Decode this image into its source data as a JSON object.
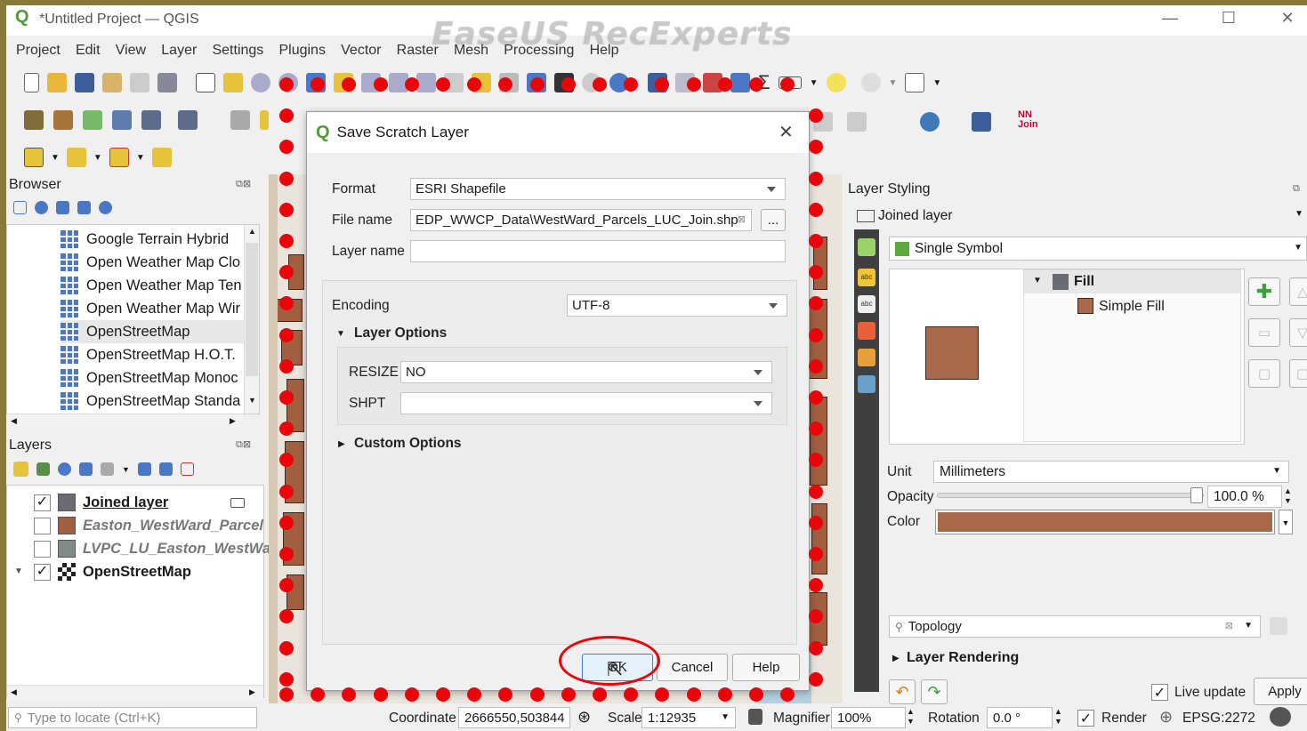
{
  "window": {
    "title": "*Untitled Project — QGIS",
    "watermark": "EaseUS RecExperts"
  },
  "menu": [
    "Project",
    "Edit",
    "View",
    "Layer",
    "Settings",
    "Plugins",
    "Vector",
    "Raster",
    "Mesh",
    "Processing",
    "Help"
  ],
  "browser": {
    "title": "Browser",
    "items": [
      "Google Terrain Hybrid",
      "Open Weather Map Clo",
      "Open Weather Map Ten",
      "Open Weather Map Wir",
      "OpenStreetMap",
      "OpenStreetMap H.O.T.",
      "OpenStreetMap Monoc",
      "OpenStreetMap Standa"
    ]
  },
  "layers": {
    "title": "Layers",
    "items": [
      {
        "name": "Joined layer",
        "checked": "✓",
        "color": "#6b6b74"
      },
      {
        "name": "Easton_WestWard_Parcel",
        "checked": "",
        "color": "#a15f40"
      },
      {
        "name": "LVPC_LU_Easton_WestWa",
        "checked": "",
        "color": "#7f8c8a"
      },
      {
        "name": "OpenStreetMap",
        "checked": "✓",
        "color": ""
      }
    ]
  },
  "dialog": {
    "title": "Save Scratch Layer",
    "format_label": "Format",
    "format_value": "ESRI Shapefile",
    "filename_label": "File name",
    "filename_value": "EDP_WWCP_Data\\WestWard_Parcels_LUC_Join.shp",
    "browse_label": "...",
    "layername_label": "Layer name",
    "layername_value": "",
    "encoding_label": "Encoding",
    "encoding_value": "UTF-8",
    "layer_options_label": "Layer Options",
    "resize_label": "RESIZE",
    "resize_value": "NO",
    "shpt_label": "SHPT",
    "shpt_value": "",
    "custom_options_label": "Custom Options",
    "ok_label": "OK",
    "cancel_label": "Cancel",
    "help_label": "Help"
  },
  "styling": {
    "title": "Layer Styling",
    "layer": "Joined layer",
    "renderer": "Single Symbol",
    "fill_label": "Fill",
    "simple_fill_label": "Simple Fill",
    "fill_color": "#a8694a",
    "unit_label": "Unit",
    "unit_value": "Millimeters",
    "opacity_label": "Opacity",
    "opacity_value": "100.0 %",
    "color_label": "Color",
    "search_value": "Topology",
    "layer_rendering_label": "Layer Rendering",
    "live_update_label": "Live update",
    "apply_label": "Apply"
  },
  "status": {
    "locate_placeholder": "Type to locate (Ctrl+K)",
    "coordinate_label": "Coordinate",
    "coordinate_value": "2666550,503844",
    "scale_label": "Scale",
    "scale_value": "1:12935",
    "magnifier_label": "Magnifier",
    "magnifier_value": "100%",
    "rotation_label": "Rotation",
    "rotation_value": "0.0 °",
    "render_label": "Render",
    "crs_label": "EPSG:2272"
  },
  "colors": {
    "annotation_red": "#e8060a",
    "parcel_brown": "#a15f40",
    "qgis_green": "#4f9c35"
  }
}
